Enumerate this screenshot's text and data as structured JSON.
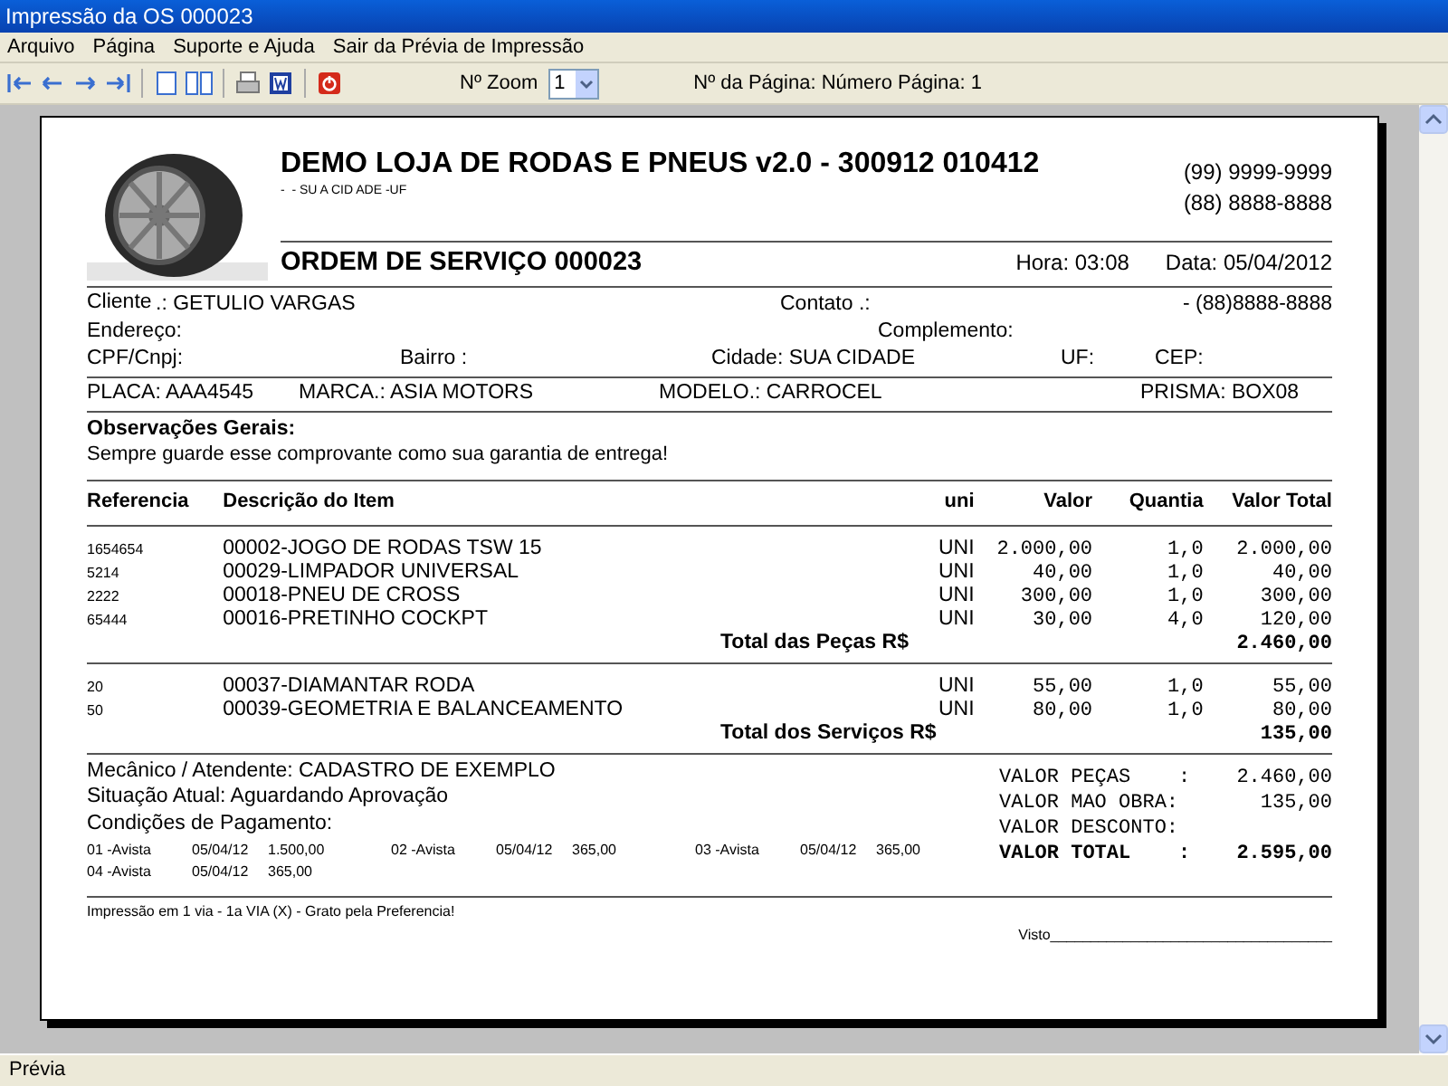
{
  "window": {
    "title": "Impressão da OS 000023"
  },
  "menu": [
    "Arquivo",
    "Página",
    "Suporte e Ajuda",
    "Sair da Prévia de Impressão"
  ],
  "toolbar": {
    "zoom_label": "Nº Zoom",
    "zoom_value": "1",
    "page_label": "Nº da Página: Número Página: 1"
  },
  "document": {
    "company": "DEMO LOJA DE RODAS E PNEUS v2.0 - 300912 010412",
    "address": "-  - SU A CID ADE -UF",
    "phones": [
      "(99) 9999-9999",
      "(88) 8888-8888"
    ],
    "order_title": "ORDEM DE SERVIÇO 000023",
    "hora": "Hora: 03:08",
    "data": "Data: 05/04/2012",
    "cliente_label": "Cliente",
    "cliente": ".: GETULIO VARGAS",
    "contato": "Contato .:",
    "telefone": "- (88)8888-8888",
    "endereco": "Endereço:",
    "complemento": "Complemento:",
    "cpf": "CPF/Cnpj:",
    "bairro": "Bairro :",
    "cidade": "Cidade: SUA CIDADE",
    "uf": "UF:",
    "cep": "CEP:",
    "placa": "PLACA: AAA4545",
    "marca": "MARCA.: ASIA MOTORS",
    "modelo": "MODELO.: CARROCEL",
    "prisma": "PRISMA: BOX08",
    "obs_title": "Observações Gerais:",
    "obs_text": "Sempre guarde esse comprovante como sua garantia de entrega!",
    "columns": [
      "Referencia",
      "Descrição do Item",
      "uni",
      "Valor",
      "Quantia",
      "Valor Total"
    ],
    "parts": [
      {
        "ref": "1654654",
        "desc": "00002-JOGO DE RODAS TSW 15",
        "uni": "UNI",
        "valor": "2.000,00",
        "qtd": "1,0",
        "total": "2.000,00"
      },
      {
        "ref": "5214",
        "desc": "00029-LIMPADOR UNIVERSAL",
        "uni": "UNI",
        "valor": "40,00",
        "qtd": "1,0",
        "total": "40,00"
      },
      {
        "ref": "2222",
        "desc": "00018-PNEU DE CROSS",
        "uni": "UNI",
        "valor": "300,00",
        "qtd": "1,0",
        "total": "300,00"
      },
      {
        "ref": "65444",
        "desc": "00016-PRETINHO COCKPT",
        "uni": "UNI",
        "valor": "30,00",
        "qtd": "4,0",
        "total": "120,00"
      }
    ],
    "parts_total": {
      "label": "Total das Peças R$",
      "value": "2.460,00"
    },
    "services": [
      {
        "ref": "20",
        "desc": "00037-DIAMANTAR RODA",
        "uni": "UNI",
        "valor": "55,00",
        "qtd": "1,0",
        "total": "55,00"
      },
      {
        "ref": "50",
        "desc": "00039-GEOMETRIA E BALANCEAMENTO",
        "uni": "UNI",
        "valor": "80,00",
        "qtd": "1,0",
        "total": "80,00"
      }
    ],
    "services_total": {
      "label": "Total dos Serviços R$",
      "value": "135,00"
    },
    "mechanic": "Mecânico / Atendente: CADASTRO DE EXEMPLO",
    "situation": "Situação Atual: Aguardando Aprovação",
    "payment_label": "Condições de Pagamento:",
    "installments": [
      {
        "number": "01 -Avista",
        "date": "05/04/12",
        "amount": "1.500,00"
      },
      {
        "number": "02 -Avista",
        "date": "05/04/12",
        "amount": "365,00"
      },
      {
        "number": "03 -Avista",
        "date": "05/04/12",
        "amount": "365,00"
      },
      {
        "number": "04 -Avista",
        "date": "05/04/12",
        "amount": "365,00"
      }
    ],
    "totals": [
      {
        "kind": "line",
        "label": "VALOR PEÇAS    :",
        "value": "2.460,00"
      },
      {
        "kind": "line",
        "label": "VALOR MAO OBRA:",
        "value": "135,00"
      },
      {
        "kind": "line",
        "label": "VALOR DESCONTO:"
      },
      {
        "kind": "grand",
        "label": "VALOR TOTAL    :",
        "value": "2.595,00"
      }
    ],
    "footer": "Impressão em 1 via  -  1a VIA (X) - Grato pela Preferencia!",
    "visto": "Visto___________________________________"
  },
  "status_bar": "Prévia"
}
